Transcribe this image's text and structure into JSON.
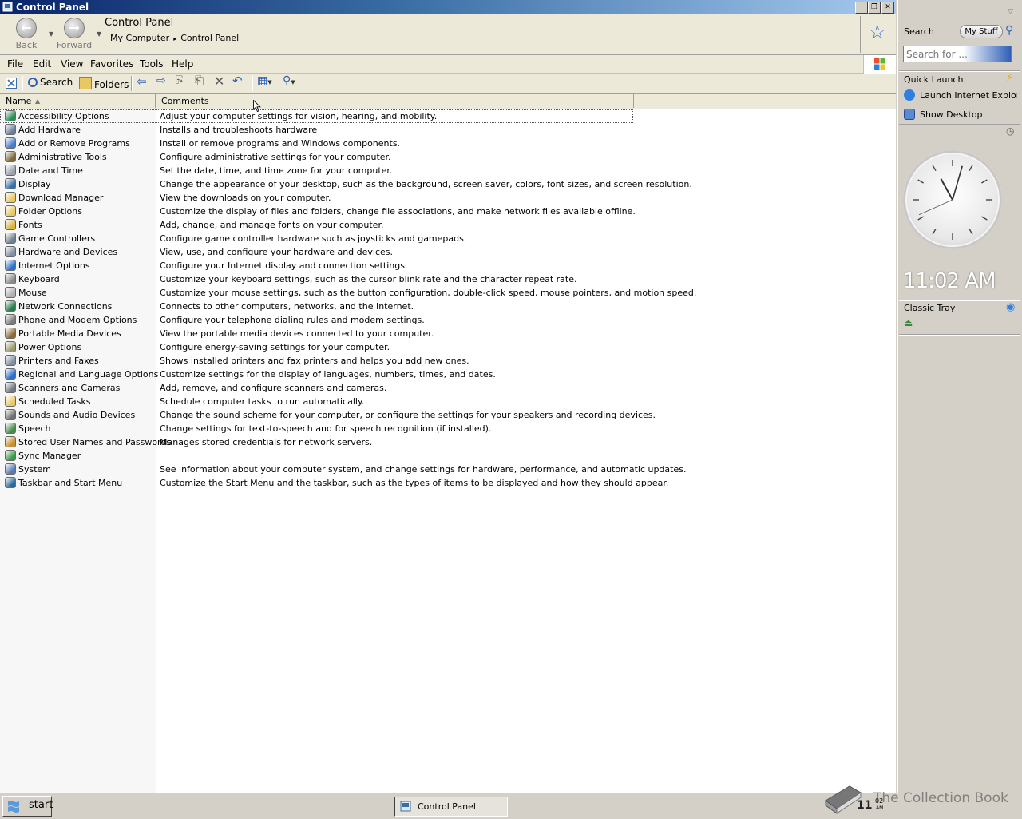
{
  "window": {
    "title": "Control Panel",
    "controls": {
      "minimize": "_",
      "restore": "❐",
      "close": "✕"
    }
  },
  "address": {
    "back_label": "Back",
    "forward_label": "Forward",
    "location_title": "Control Panel",
    "crumbs": [
      "My Computer",
      "Control Panel"
    ]
  },
  "menu": [
    "File",
    "Edit",
    "View",
    "Favorites",
    "Tools",
    "Help"
  ],
  "toolbar": {
    "search_label": "Search",
    "folders_label": "Folders"
  },
  "columns": {
    "name": "Name",
    "comments": "Comments"
  },
  "items": [
    {
      "name": "Accessibility Options",
      "comment": "Adjust your computer settings for vision, hearing, and mobility.",
      "color": "#2e8b57"
    },
    {
      "name": "Add Hardware",
      "comment": "Installs and troubleshoots hardware",
      "color": "#6b7f99"
    },
    {
      "name": "Add or Remove Programs",
      "comment": "Install or remove programs and Windows components.",
      "color": "#4a7cc9"
    },
    {
      "name": "Administrative Tools",
      "comment": "Configure administrative settings for your computer.",
      "color": "#7d6a3a"
    },
    {
      "name": "Date and Time",
      "comment": "Set the date, time, and time zone for your computer.",
      "color": "#9aa3ad"
    },
    {
      "name": "Display",
      "comment": "Change the appearance of your desktop, such as the background, screen saver, colors, font sizes, and screen resolution.",
      "color": "#3a6ea5"
    },
    {
      "name": "Download Manager",
      "comment": "View the downloads on your computer.",
      "color": "#e8c862"
    },
    {
      "name": "Folder Options",
      "comment": "Customize the display of files and folders, change file associations, and make network files available offline.",
      "color": "#e8c862"
    },
    {
      "name": "Fonts",
      "comment": "Add, change, and manage fonts on your computer.",
      "color": "#d8b440"
    },
    {
      "name": "Game Controllers",
      "comment": "Configure game controller hardware such as joysticks and gamepads.",
      "color": "#6f7f8f"
    },
    {
      "name": "Hardware and Devices",
      "comment": "View, use, and configure your hardware and devices.",
      "color": "#8090a0"
    },
    {
      "name": "Internet Options",
      "comment": "Configure your Internet display and connection settings.",
      "color": "#2f6fc8"
    },
    {
      "name": "Keyboard",
      "comment": "Customize your keyboard settings, such as the cursor blink rate and the character repeat rate.",
      "color": "#8a8a8a"
    },
    {
      "name": "Mouse",
      "comment": "Customize your mouse settings, such as the button configuration, double-click speed, mouse pointers, and motion speed.",
      "color": "#b0b0b0"
    },
    {
      "name": "Network Connections",
      "comment": "Connects to other computers, networks, and the Internet.",
      "color": "#2a7a4a"
    },
    {
      "name": "Phone and Modem Options",
      "comment": "Configure your telephone dialing rules and modem settings.",
      "color": "#7a7a7a"
    },
    {
      "name": "Portable Media Devices",
      "comment": "View the portable media devices connected to your computer.",
      "color": "#8a6a3a"
    },
    {
      "name": "Power Options",
      "comment": "Configure energy-saving settings for your computer.",
      "color": "#9a9a70"
    },
    {
      "name": "Printers and Faxes",
      "comment": "Shows installed printers and fax printers and helps you add new ones.",
      "color": "#8090a0"
    },
    {
      "name": "Regional and Language Options",
      "comment": "Customize settings for the display of languages, numbers, times, and dates.",
      "color": "#2f6fc8"
    },
    {
      "name": "Scanners and Cameras",
      "comment": "Add, remove, and configure scanners and cameras.",
      "color": "#707880"
    },
    {
      "name": "Scheduled Tasks",
      "comment": "Schedule computer tasks to run automatically.",
      "color": "#e8c862"
    },
    {
      "name": "Sounds and Audio Devices",
      "comment": "Change the sound scheme for your computer, or configure the settings for your speakers and recording devices.",
      "color": "#707070"
    },
    {
      "name": "Speech",
      "comment": "Change settings for text-to-speech and for speech recognition (if installed).",
      "color": "#4a8a4a"
    },
    {
      "name": "Stored User Names and Passwords",
      "comment": "Manages stored credentials for network servers.",
      "color": "#c89030"
    },
    {
      "name": "Sync Manager",
      "comment": "",
      "color": "#3a9a4a"
    },
    {
      "name": "System",
      "comment": "See information about your computer system, and change settings for hardware, performance, and automatic updates.",
      "color": "#5a7ab0"
    },
    {
      "name": "Taskbar and Start Menu",
      "comment": "Customize the Start Menu and the taskbar, such as the types of items to be displayed and how they should appear.",
      "color": "#2a6a9a"
    }
  ],
  "sidebar": {
    "search_title": "Search",
    "my_stuff_label": "My Stuff",
    "search_placeholder": "Search for ...",
    "quick_launch_title": "Quick Launch",
    "quick_launch_items": [
      "Launch Internet Explorer Browser",
      "Show Desktop"
    ],
    "clock_time": "11:02 AM",
    "clock_hours": 11,
    "clock_minutes": 2,
    "clock_seconds": 41,
    "classic_tray_title": "Classic Tray"
  },
  "taskbar": {
    "start_label": "start",
    "task_label": "Control Panel",
    "tray_hour": "11",
    "tray_minute": "02",
    "tray_ampm": "AM",
    "watermark": "The Collection Book"
  }
}
